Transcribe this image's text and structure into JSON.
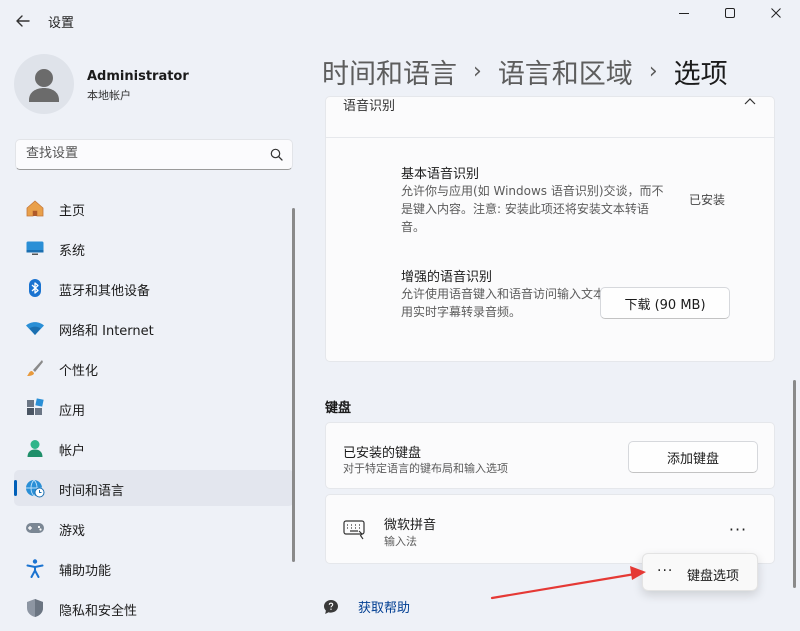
{
  "window": {
    "title": "设置",
    "back_icon": "back-arrow-icon",
    "controls": [
      "minimize-icon",
      "maximize-icon",
      "close-icon"
    ]
  },
  "profile": {
    "name": "Administrator",
    "account_type": "本地帐户"
  },
  "search": {
    "placeholder": "查找设置",
    "value": ""
  },
  "sidebar": {
    "items": [
      {
        "label": "主页",
        "icon": "home-icon",
        "active": false
      },
      {
        "label": "系统",
        "icon": "monitor-icon",
        "active": false
      },
      {
        "label": "蓝牙和其他设备",
        "icon": "bluetooth-icon",
        "active": false
      },
      {
        "label": "网络和 Internet",
        "icon": "wifi-icon",
        "active": false
      },
      {
        "label": "个性化",
        "icon": "brush-icon",
        "active": false
      },
      {
        "label": "应用",
        "icon": "apps-icon",
        "active": false
      },
      {
        "label": "帐户",
        "icon": "person-icon",
        "active": false
      },
      {
        "label": "时间和语言",
        "icon": "globe-clock-icon",
        "active": true
      },
      {
        "label": "游戏",
        "icon": "gamepad-icon",
        "active": false
      },
      {
        "label": "辅助功能",
        "icon": "accessibility-icon",
        "active": false
      },
      {
        "label": "隐私和安全性",
        "icon": "shield-icon",
        "active": false
      }
    ]
  },
  "breadcrumb": {
    "items": [
      "时间和语言",
      "语言和区域",
      "选项"
    ],
    "separator": "›"
  },
  "speech_section": {
    "header_label": "语音识别",
    "basic": {
      "title": "基本语音识别",
      "description": "允许你与应用(如 Windows 语音识别)交谈，而不是键入内容。注意: 安装此项还将安装文本转语音。",
      "status": "已安装"
    },
    "enhanced": {
      "title": "增强的语音识别",
      "description": "允许使用语音键入和语音访问输入文本。它还可使用实时字幕转录音频。",
      "button_label": "下载 (90 MB)"
    }
  },
  "keyboard_section": {
    "heading": "键盘",
    "installed": {
      "title": "已安装的键盘",
      "description": "对于特定语言的键布局和输入选项",
      "button_label": "添加键盘"
    },
    "ime": {
      "name": "微软拼音",
      "type": "输入法",
      "more_label": "···"
    }
  },
  "context_menu": {
    "dots": "···",
    "item_label": "键盘选项"
  },
  "help": {
    "label": "获取帮助"
  },
  "colors": {
    "accent": "#005fb8",
    "annotation_arrow": "#e53935",
    "link": "#003e92"
  }
}
